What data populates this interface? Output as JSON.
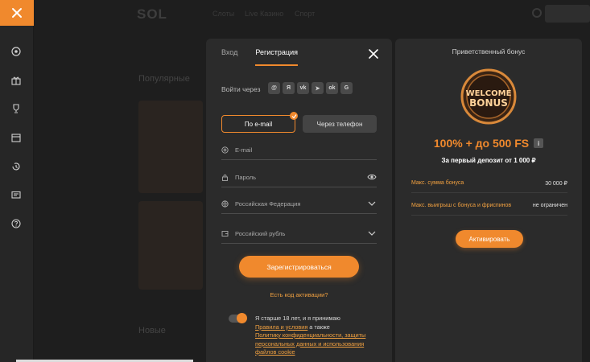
{
  "header": {
    "logo": "SOL",
    "nav": [
      "Слоты",
      "Live Казино",
      "Спорт"
    ]
  },
  "background": {
    "section_title": "Популярные",
    "new_section": "Новые"
  },
  "sidebar": {
    "icons": [
      "soccer-ball-icon",
      "gift-icon",
      "trophy-icon",
      "calendar-icon",
      "history-icon",
      "chat-icon",
      "help-icon"
    ]
  },
  "auth_modal": {
    "tabs": [
      {
        "label": "Вход",
        "active": false
      },
      {
        "label": "Регистрация",
        "active": true
      }
    ],
    "social_label": "Войти через",
    "social_buttons": [
      {
        "icon": "mail-ru-icon",
        "glyph": "@"
      },
      {
        "icon": "yandex-icon",
        "glyph": "Я"
      },
      {
        "icon": "vk-icon",
        "glyph": "vk"
      },
      {
        "icon": "telegram-icon",
        "glyph": "➤"
      },
      {
        "icon": "odnoklassniki-icon",
        "glyph": "ok"
      },
      {
        "icon": "google-icon",
        "glyph": "G"
      }
    ],
    "method_email": "По e-mail",
    "method_phone": "Через телефон",
    "email_placeholder": "E-mail",
    "password_placeholder": "Пароль",
    "country_value": "Российская Федерация",
    "currency_value": "Российский рубль",
    "register_button": "Зарегистрироваться",
    "activation_link": "Есть код активации?",
    "terms": {
      "text1": "Я старше 18 лет, и я принимаю",
      "link1": "Правила и условия",
      "text2": " а также",
      "link2": "Политику конфиденциальности, защиты персональных данных и использования файлов cookie"
    }
  },
  "bonus_panel": {
    "title": "Приветственный бонус",
    "badge_line1": "WELCOME",
    "badge_line2": "BONUS",
    "amount": "100% + до 500 FS",
    "info_glyph": "i",
    "subtitle": "За первый депозит от 1 000 ₽",
    "rows": [
      {
        "key": "Макс. сумма бонуса",
        "value": "30 000 ₽"
      },
      {
        "key": "Макс. выигрыш с бонуса и фриспинов",
        "value": "не ограничен"
      }
    ],
    "activate_button": "Активировать"
  },
  "colors": {
    "accent": "#f0892d",
    "panel": "#2b2b2b",
    "background": "#1b1b1b",
    "link": "#f0a040"
  }
}
